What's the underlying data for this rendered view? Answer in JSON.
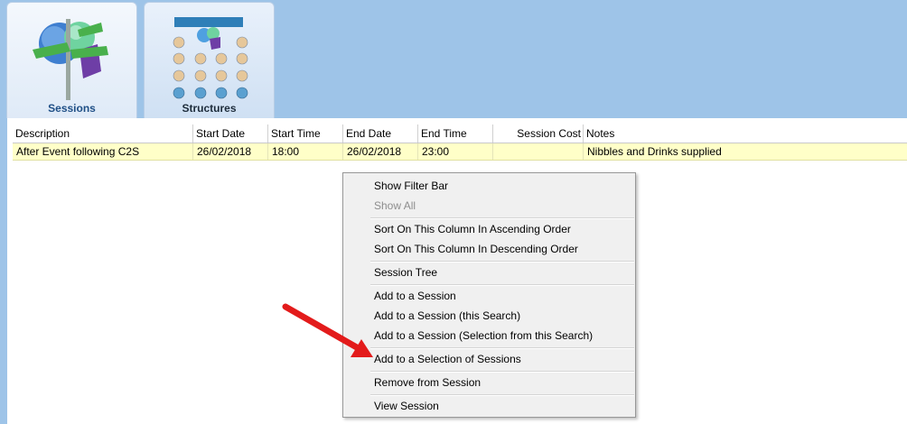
{
  "tabs": [
    {
      "label": "Sessions",
      "active": true,
      "icon": "signpost-globe-icon"
    },
    {
      "label": "Structures",
      "active": false,
      "icon": "seating-structure-icon"
    }
  ],
  "grid": {
    "columns": [
      "Description",
      "Start Date",
      "Start Time",
      "End Date",
      "End Time",
      "Session Cost",
      "Notes"
    ],
    "rows": [
      {
        "description": "After Event following C2S",
        "start_date": "26/02/2018",
        "start_time": "18:00",
        "end_date": "26/02/2018",
        "end_time": "23:00",
        "session_cost": "",
        "notes": "Nibbles and Drinks supplied"
      }
    ],
    "selected_row_color": "#ffffc8"
  },
  "context_menu": {
    "items": [
      {
        "label": "Show Filter Bar",
        "enabled": true
      },
      {
        "label": "Show All",
        "enabled": false
      },
      {
        "label": "Sort On This Column In Ascending Order",
        "enabled": true
      },
      {
        "label": "Sort On This Column In Descending Order",
        "enabled": true
      },
      {
        "label": "Session Tree",
        "enabled": true
      },
      {
        "label": "Add to a Session",
        "enabled": true
      },
      {
        "label": "Add to a Session (this Search)",
        "enabled": true
      },
      {
        "label": "Add to a Session (Selection from this Search)",
        "enabled": true
      },
      {
        "label": "Add to a Selection of Sessions",
        "enabled": true
      },
      {
        "label": "Remove from Session",
        "enabled": true
      },
      {
        "label": "View Session",
        "enabled": true
      }
    ]
  },
  "annotation": {
    "icon": "red-arrow-icon",
    "color": "#e31b1b"
  },
  "colors": {
    "background_band": "#9ec4e8",
    "tab_text": "#1f4f86"
  }
}
